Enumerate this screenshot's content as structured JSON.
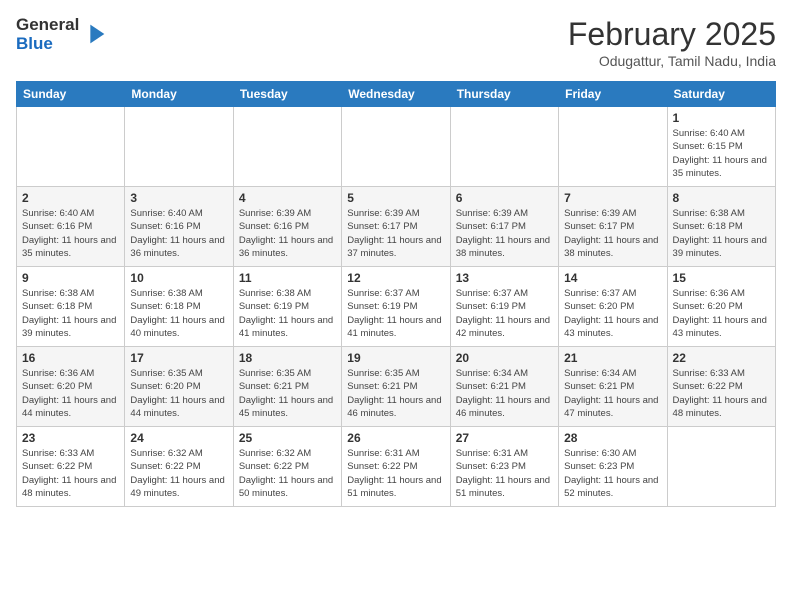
{
  "logo": {
    "general": "General",
    "blue": "Blue"
  },
  "header": {
    "month": "February 2025",
    "location": "Odugattur, Tamil Nadu, India"
  },
  "weekdays": [
    "Sunday",
    "Monday",
    "Tuesday",
    "Wednesday",
    "Thursday",
    "Friday",
    "Saturday"
  ],
  "weeks": [
    [
      null,
      null,
      null,
      null,
      null,
      null,
      {
        "day": "1",
        "sunrise": "6:40 AM",
        "sunset": "6:15 PM",
        "daylight": "11 hours and 35 minutes."
      }
    ],
    [
      {
        "day": "2",
        "sunrise": "6:40 AM",
        "sunset": "6:16 PM",
        "daylight": "11 hours and 35 minutes."
      },
      {
        "day": "3",
        "sunrise": "6:40 AM",
        "sunset": "6:16 PM",
        "daylight": "11 hours and 36 minutes."
      },
      {
        "day": "4",
        "sunrise": "6:39 AM",
        "sunset": "6:16 PM",
        "daylight": "11 hours and 36 minutes."
      },
      {
        "day": "5",
        "sunrise": "6:39 AM",
        "sunset": "6:17 PM",
        "daylight": "11 hours and 37 minutes."
      },
      {
        "day": "6",
        "sunrise": "6:39 AM",
        "sunset": "6:17 PM",
        "daylight": "11 hours and 38 minutes."
      },
      {
        "day": "7",
        "sunrise": "6:39 AM",
        "sunset": "6:17 PM",
        "daylight": "11 hours and 38 minutes."
      },
      {
        "day": "8",
        "sunrise": "6:38 AM",
        "sunset": "6:18 PM",
        "daylight": "11 hours and 39 minutes."
      }
    ],
    [
      {
        "day": "9",
        "sunrise": "6:38 AM",
        "sunset": "6:18 PM",
        "daylight": "11 hours and 39 minutes."
      },
      {
        "day": "10",
        "sunrise": "6:38 AM",
        "sunset": "6:18 PM",
        "daylight": "11 hours and 40 minutes."
      },
      {
        "day": "11",
        "sunrise": "6:38 AM",
        "sunset": "6:19 PM",
        "daylight": "11 hours and 41 minutes."
      },
      {
        "day": "12",
        "sunrise": "6:37 AM",
        "sunset": "6:19 PM",
        "daylight": "11 hours and 41 minutes."
      },
      {
        "day": "13",
        "sunrise": "6:37 AM",
        "sunset": "6:19 PM",
        "daylight": "11 hours and 42 minutes."
      },
      {
        "day": "14",
        "sunrise": "6:37 AM",
        "sunset": "6:20 PM",
        "daylight": "11 hours and 43 minutes."
      },
      {
        "day": "15",
        "sunrise": "6:36 AM",
        "sunset": "6:20 PM",
        "daylight": "11 hours and 43 minutes."
      }
    ],
    [
      {
        "day": "16",
        "sunrise": "6:36 AM",
        "sunset": "6:20 PM",
        "daylight": "11 hours and 44 minutes."
      },
      {
        "day": "17",
        "sunrise": "6:35 AM",
        "sunset": "6:20 PM",
        "daylight": "11 hours and 44 minutes."
      },
      {
        "day": "18",
        "sunrise": "6:35 AM",
        "sunset": "6:21 PM",
        "daylight": "11 hours and 45 minutes."
      },
      {
        "day": "19",
        "sunrise": "6:35 AM",
        "sunset": "6:21 PM",
        "daylight": "11 hours and 46 minutes."
      },
      {
        "day": "20",
        "sunrise": "6:34 AM",
        "sunset": "6:21 PM",
        "daylight": "11 hours and 46 minutes."
      },
      {
        "day": "21",
        "sunrise": "6:34 AM",
        "sunset": "6:21 PM",
        "daylight": "11 hours and 47 minutes."
      },
      {
        "day": "22",
        "sunrise": "6:33 AM",
        "sunset": "6:22 PM",
        "daylight": "11 hours and 48 minutes."
      }
    ],
    [
      {
        "day": "23",
        "sunrise": "6:33 AM",
        "sunset": "6:22 PM",
        "daylight": "11 hours and 48 minutes."
      },
      {
        "day": "24",
        "sunrise": "6:32 AM",
        "sunset": "6:22 PM",
        "daylight": "11 hours and 49 minutes."
      },
      {
        "day": "25",
        "sunrise": "6:32 AM",
        "sunset": "6:22 PM",
        "daylight": "11 hours and 50 minutes."
      },
      {
        "day": "26",
        "sunrise": "6:31 AM",
        "sunset": "6:22 PM",
        "daylight": "11 hours and 51 minutes."
      },
      {
        "day": "27",
        "sunrise": "6:31 AM",
        "sunset": "6:23 PM",
        "daylight": "11 hours and 51 minutes."
      },
      {
        "day": "28",
        "sunrise": "6:30 AM",
        "sunset": "6:23 PM",
        "daylight": "11 hours and 52 minutes."
      },
      null
    ]
  ]
}
